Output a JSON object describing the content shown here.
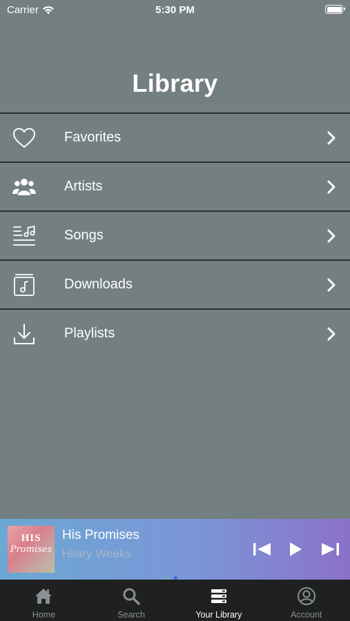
{
  "status_bar": {
    "carrier": "Carrier",
    "time": "5:30 PM"
  },
  "header": {
    "title": "Library"
  },
  "menu": {
    "items": [
      {
        "label": "Favorites",
        "icon": "heart-icon"
      },
      {
        "label": "Artists",
        "icon": "people-icon"
      },
      {
        "label": "Songs",
        "icon": "song-list-icon"
      },
      {
        "label": "Downloads",
        "icon": "music-box-icon"
      },
      {
        "label": "Playlists",
        "icon": "download-icon"
      }
    ]
  },
  "now_playing": {
    "title": "His Promises",
    "artist": "Hilary Weeks",
    "art_text_line1": "HIS",
    "art_text_line2": "Promises",
    "page_count": 3,
    "active_page": 3
  },
  "tab_bar": {
    "tabs": [
      {
        "label": "Home",
        "icon": "home-icon"
      },
      {
        "label": "Search",
        "icon": "search-icon"
      },
      {
        "label": "Your Library",
        "icon": "library-icon",
        "active": true
      },
      {
        "label": "Account",
        "icon": "account-icon"
      }
    ]
  },
  "colors": {
    "background": "#737f80",
    "divider": "#2b2f31",
    "tab_bar": "#1f2121",
    "tab_inactive": "#8a8f92",
    "player_gradient_start": "#6ba8d3",
    "player_gradient_end": "#8b72c9"
  }
}
